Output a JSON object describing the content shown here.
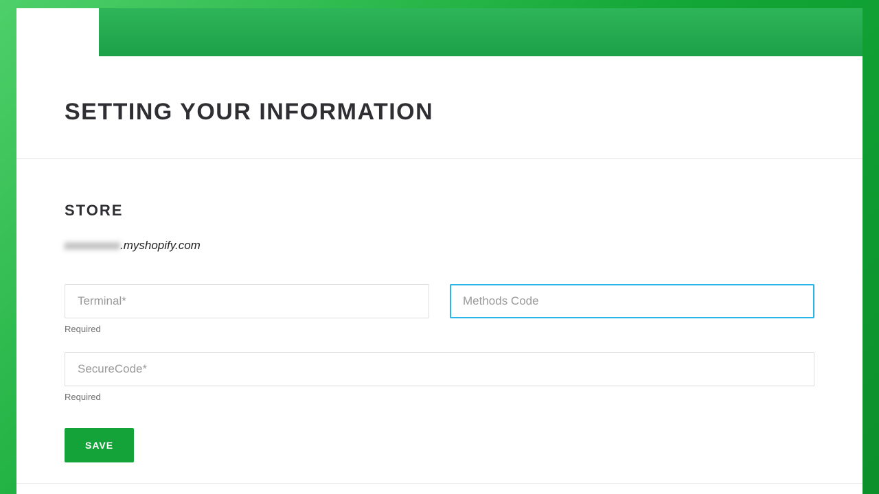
{
  "page": {
    "title": "Setting Your Information"
  },
  "store": {
    "section_label": "Store",
    "masked_prefix": "xxxxxxxxx",
    "domain_suffix": ".myshopify.com"
  },
  "fields": {
    "terminal": {
      "placeholder": "Terminal*",
      "helper": "Required"
    },
    "methods_code": {
      "placeholder": "Methods Code"
    },
    "secure_code": {
      "placeholder": "SecureCode*",
      "helper": "Required"
    }
  },
  "buttons": {
    "save": "SAVE"
  }
}
